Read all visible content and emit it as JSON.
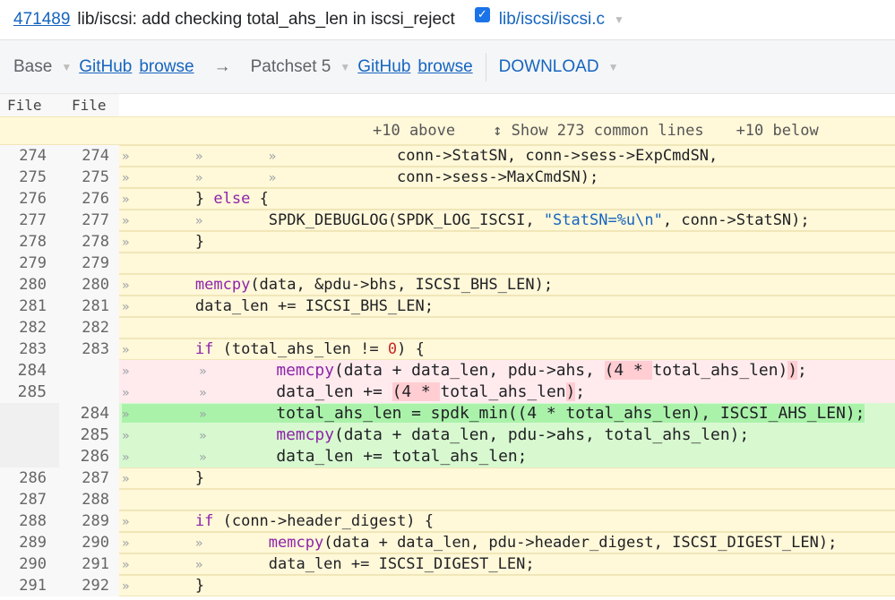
{
  "header": {
    "change_number": "471489",
    "title": "lib/iscsi: add checking total_ahs_len in iscsi_reject",
    "file_path": "lib/iscsi/iscsi.c",
    "reviewed_checked": true
  },
  "toolbar": {
    "base": "Base",
    "github1": "GitHub",
    "browse1": "browse",
    "arrow": "→",
    "patchset": "Patchset 5",
    "github2": "GitHub",
    "browse2": "browse",
    "download": "DOWNLOAD"
  },
  "columns": {
    "left": "File",
    "right": "File"
  },
  "context": {
    "above": "+10 above",
    "show": "Show 273 common lines",
    "below": "+10 below"
  },
  "lines": [
    {
      "o": "274",
      "n": "274",
      "t": "ctx",
      "s": [
        [
          "\t\t\t      conn->StatSN, conn->sess->ExpCmdSN,"
        ]
      ]
    },
    {
      "o": "275",
      "n": "275",
      "t": "ctx",
      "s": [
        [
          "\t\t\t      conn->sess->MaxCmdSN);"
        ]
      ]
    },
    {
      "o": "276",
      "n": "276",
      "t": "ctx",
      "s": [
        [
          "\t} else {"
        ]
      ]
    },
    {
      "o": "277",
      "n": "277",
      "t": "ctx",
      "s": [
        [
          "\t\tSPDK_DEBUGLOG(SPDK_LOG_ISCSI, \"StatSN=%u\\n\", conn->StatSN);"
        ]
      ]
    },
    {
      "o": "278",
      "n": "278",
      "t": "ctx",
      "s": [
        [
          "\t}"
        ]
      ]
    },
    {
      "o": "279",
      "n": "279",
      "t": "ctx",
      "s": [
        [
          ""
        ]
      ]
    },
    {
      "o": "280",
      "n": "280",
      "t": "ctx",
      "s": [
        [
          "\tmemcpy(data, &pdu->bhs, ISCSI_BHS_LEN);"
        ]
      ]
    },
    {
      "o": "281",
      "n": "281",
      "t": "ctx",
      "s": [
        [
          "\tdata_len += ISCSI_BHS_LEN;"
        ]
      ]
    },
    {
      "o": "282",
      "n": "282",
      "t": "ctx",
      "s": [
        [
          ""
        ]
      ]
    },
    {
      "o": "283",
      "n": "283",
      "t": "ctx",
      "s": [
        [
          "\tif (total_ahs_len != 0) {"
        ]
      ]
    },
    {
      "o": "284",
      "n": "",
      "t": "del",
      "s": [
        [
          "\t\tmemcpy(data + data_len, pdu->ahs, "
        ],
        [
          "(4 * ",
          1
        ],
        [
          "total_ahs_len)"
        ],
        [
          ")",
          1
        ],
        [
          ";"
        ]
      ]
    },
    {
      "o": "285",
      "n": "",
      "t": "del",
      "s": [
        [
          "\t\tdata_len += "
        ],
        [
          "(4 * ",
          1
        ],
        [
          "total_ahs_len"
        ],
        [
          ")",
          1
        ],
        [
          ";"
        ]
      ]
    },
    {
      "o": "",
      "n": "284",
      "t": "add",
      "s": [
        [
          "\t\ttotal_ahs_len = spdk_min((4 * total_ahs_len), ISCSI_AHS_LEN);",
          1
        ]
      ]
    },
    {
      "o": "",
      "n": "285",
      "t": "add",
      "s": [
        [
          "\t\tmemcpy(data + data_len, pdu->ahs, total_ahs_len);"
        ]
      ]
    },
    {
      "o": "",
      "n": "286",
      "t": "add",
      "s": [
        [
          "\t\tdata_len += total_ahs_len;"
        ]
      ]
    },
    {
      "o": "286",
      "n": "287",
      "t": "ctx",
      "s": [
        [
          "\t}"
        ]
      ]
    },
    {
      "o": "287",
      "n": "288",
      "t": "ctx",
      "s": [
        [
          ""
        ]
      ]
    },
    {
      "o": "288",
      "n": "289",
      "t": "ctx",
      "s": [
        [
          "\tif (conn->header_digest) {"
        ]
      ]
    },
    {
      "o": "289",
      "n": "290",
      "t": "ctx",
      "s": [
        [
          "\t\tmemcpy(data + data_len, pdu->header_digest, ISCSI_DIGEST_LEN);"
        ]
      ]
    },
    {
      "o": "290",
      "n": "291",
      "t": "ctx",
      "s": [
        [
          "\t\tdata_len += ISCSI_DIGEST_LEN;"
        ]
      ]
    },
    {
      "o": "291",
      "n": "292",
      "t": "ctx",
      "s": [
        [
          "\t}"
        ]
      ]
    }
  ]
}
